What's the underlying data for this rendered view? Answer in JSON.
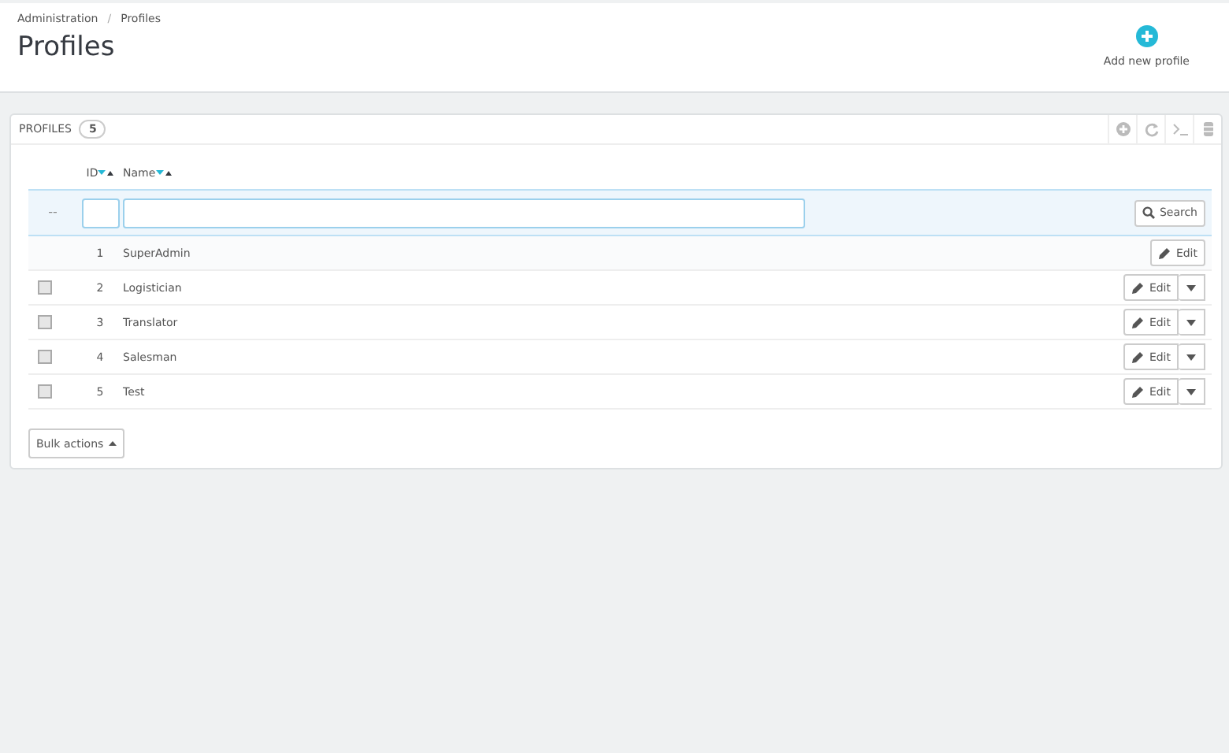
{
  "breadcrumb": {
    "items": [
      "Administration",
      "Profiles"
    ],
    "separator": "/"
  },
  "page_title": "Profiles",
  "toolbar": {
    "add_button": "Add new profile"
  },
  "panel": {
    "title": "PROFILES",
    "count": "5"
  },
  "table": {
    "columns": [
      {
        "label": "ID"
      },
      {
        "label": "Name"
      }
    ],
    "filter": {
      "marker": "--",
      "search_button": "Search"
    },
    "rows": [
      {
        "kind": "fixed",
        "id": "1",
        "name": "SuperAdmin",
        "action": "Edit"
      },
      {
        "kind": "editable",
        "checked": false,
        "id": "2",
        "name": "Logistician",
        "action": "Edit"
      },
      {
        "kind": "editable",
        "checked": false,
        "id": "3",
        "name": "Translator",
        "action": "Edit"
      },
      {
        "kind": "editable",
        "checked": false,
        "id": "4",
        "name": "Salesman",
        "action": "Edit"
      },
      {
        "kind": "editable",
        "checked": false,
        "id": "5",
        "name": "Test",
        "action": "Edit"
      }
    ]
  },
  "bulk_button": "Bulk actions"
}
